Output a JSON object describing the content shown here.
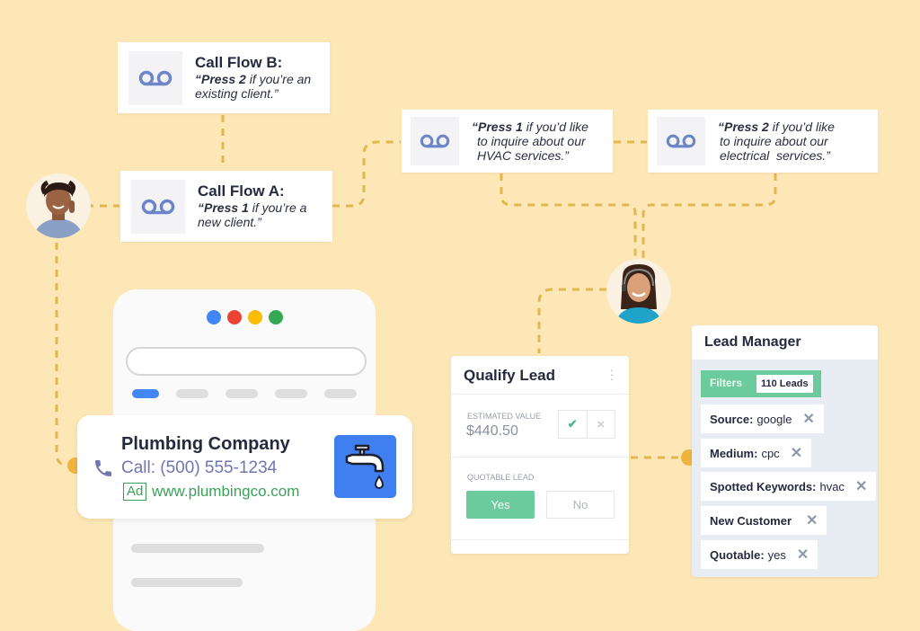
{
  "call_flows": [
    {
      "id": "b",
      "title": "Call Flow B:",
      "emphasis": "“Press 2",
      "rest_line1": " if you’re an",
      "line2": "existing client.”",
      "icon": "voicemail-icon"
    },
    {
      "id": "a",
      "title": "Call Flow A:",
      "emphasis": "“Press 1",
      "rest_line1": " if you’re a",
      "line2": "new client.”",
      "icon": "voicemail-icon"
    }
  ],
  "menu_options": [
    {
      "emphasis": "“Press 1",
      "rest_line1": " if you’d like",
      "line2": "to inquire about our",
      "line3": "HVAC services.”",
      "icon": "voicemail-icon"
    },
    {
      "emphasis": "“Press 2",
      "rest_line1": " if you’d like",
      "line2": "to inquire about our",
      "line3": "electrical  services.”",
      "icon": "voicemail-icon"
    }
  ],
  "search_result": {
    "company": "Plumbing Company",
    "phone": "Call: (500) 555-1234",
    "ad_badge": "Ad",
    "url": "www.plumbingco.com",
    "icon": "faucet-icon"
  },
  "qualify_lead": {
    "title": "Qualify Lead",
    "estimated_value_label": "ESTIMATED VALUE",
    "estimated_value": "$440.50",
    "quotable_label": "QUOTABLE LEAD",
    "yes_label": "Yes",
    "no_label": "No",
    "selected": "Yes"
  },
  "lead_manager": {
    "title": "Lead Manager",
    "filters_label": "Filters",
    "lead_count": "110 Leads",
    "filters": [
      {
        "key": "Source:",
        "value": "google"
      },
      {
        "key": "Medium:",
        "value": "cpc"
      },
      {
        "key": "Spotted Keywords:",
        "value": "hvac"
      },
      {
        "key": "New Customer",
        "value": ""
      },
      {
        "key": "Quotable:",
        "value": "yes"
      }
    ]
  },
  "colors": {
    "background": "#fde7b6",
    "connector": "#e5b54c",
    "accent_green": "#6fcf9b",
    "voicemail_blue": "#6e86c8",
    "google_blue": "#4285f4",
    "google_red": "#ea4335",
    "google_yellow": "#fbbc05",
    "google_green": "#34a853"
  }
}
